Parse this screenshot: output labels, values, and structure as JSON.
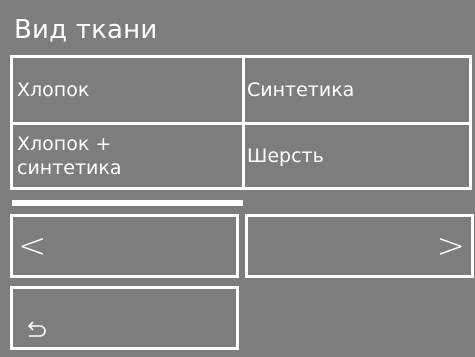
{
  "header": {
    "title": "Вид ткани"
  },
  "options": [
    {
      "label": "Хлопок"
    },
    {
      "label": "Синтетика"
    },
    {
      "label": "Хлопок +\nсинтетика"
    },
    {
      "label": "Шерсть"
    }
  ],
  "navigation": {
    "prev_label": "<",
    "next_label": ">",
    "back_icon": "return-arrow-icon"
  },
  "progress": {
    "fraction": 0.5
  },
  "colors": {
    "background": "#7d7d7d",
    "foreground": "#ffffff"
  }
}
